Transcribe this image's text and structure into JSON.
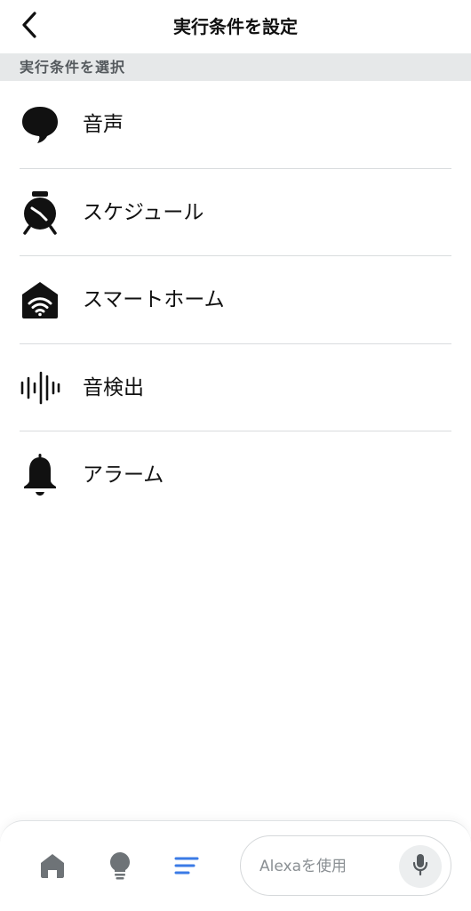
{
  "header": {
    "title": "実行条件を設定",
    "back_icon": "chevron-left-icon"
  },
  "section": {
    "label": "実行条件を選択"
  },
  "triggers": [
    {
      "label": "音声",
      "icon": "speech-bubble-icon"
    },
    {
      "label": "スケジュール",
      "icon": "alarm-clock-icon"
    },
    {
      "label": "スマートホーム",
      "icon": "smart-home-icon"
    },
    {
      "label": "音検出",
      "icon": "sound-wave-icon"
    },
    {
      "label": "アラーム",
      "icon": "bell-icon"
    }
  ],
  "bottom_nav": {
    "items": [
      {
        "icon": "home-icon",
        "active": false
      },
      {
        "icon": "lightbulb-icon",
        "active": false
      },
      {
        "icon": "menu-lines-icon",
        "active": true
      }
    ],
    "alexa_placeholder": "Alexaを使用",
    "mic_icon": "microphone-icon"
  },
  "colors": {
    "accent": "#3b7be6",
    "icon_dark": "#111111",
    "nav_icon": "#6e7377",
    "section_bg": "#e6e8e9",
    "section_text": "#555a5e",
    "divider": "#d9dcde"
  }
}
